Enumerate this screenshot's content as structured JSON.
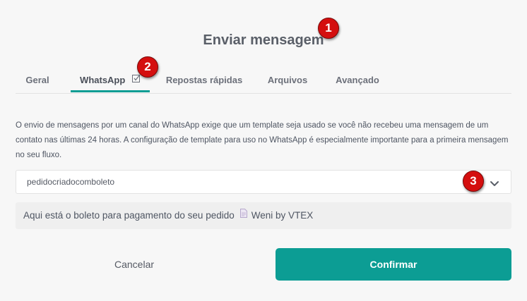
{
  "dialog": {
    "title": "Enviar mensagem"
  },
  "annotations": {
    "badge1": "1",
    "badge2": "2",
    "badge3": "3"
  },
  "tabs": [
    {
      "label": "Geral",
      "active": false
    },
    {
      "label": "WhatsApp",
      "active": true,
      "icon": "checkbox-edit-icon"
    },
    {
      "label": "Repostas rápidas",
      "active": false
    },
    {
      "label": "Arquivos",
      "active": false
    },
    {
      "label": "Avançado",
      "active": false
    }
  ],
  "description": "O envio de mensagens por um canal do WhatsApp exige que um template seja usado se você não recebeu uma mensagem de um contato nas últimas 24 horas. A configuração de template para uso no WhatsApp é especialmente importante para a primeira mensagem no seu fluxo.",
  "template_select": {
    "value": "pedidocriadocomboleto",
    "icon": "chevron-down-icon"
  },
  "preview": {
    "text_before": "Aqui está o boleto para pagamento do seu pedido",
    "icon": "document-icon",
    "text_after": "Weni by VTEX"
  },
  "actions": {
    "cancel_label": "Cancelar",
    "confirm_label": "Confirmar"
  },
  "colors": {
    "accent": "#0c9d94",
    "badge": "#d40f0f",
    "background": "#f7f7f7"
  }
}
